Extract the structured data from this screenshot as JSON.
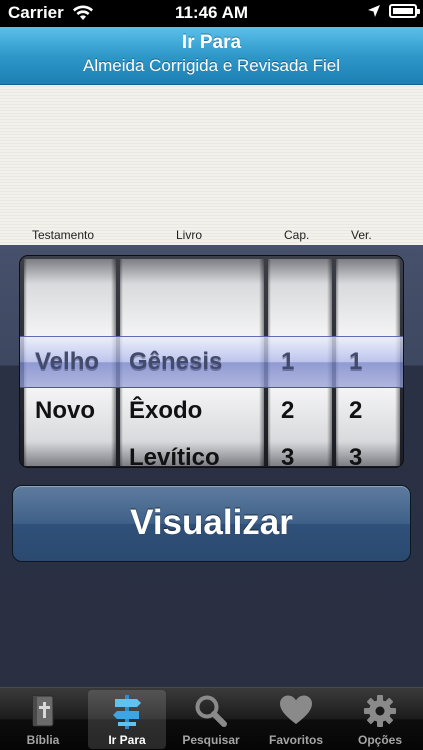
{
  "status_bar": {
    "carrier": "Carrier",
    "time": "11:46 AM"
  },
  "nav": {
    "title": "Ir Para",
    "subtitle": "Almeida Corrigida e Revisada Fiel"
  },
  "picker": {
    "column_labels": {
      "testamento": "Testamento",
      "livro": "Livro",
      "cap": "Cap.",
      "ver": "Ver."
    },
    "selected": {
      "testamento": "Velho",
      "livro": "Gênesis",
      "cap": "1",
      "ver": "1"
    },
    "testamento_items": [
      "Velho",
      "Novo"
    ],
    "livro_items": [
      "Gênesis",
      "Êxodo",
      "Levítico"
    ],
    "cap_items": [
      "1",
      "2",
      "3"
    ],
    "ver_items": [
      "1",
      "2",
      "3"
    ]
  },
  "view_button_label": "Visualizar",
  "tabs": [
    {
      "label": "Bíblia",
      "icon": "bible-icon",
      "selected": false
    },
    {
      "label": "Ir Para",
      "icon": "signpost-icon",
      "selected": true
    },
    {
      "label": "Pesquisar",
      "icon": "magnifier-icon",
      "selected": false
    },
    {
      "label": "Favoritos",
      "icon": "heart-icon",
      "selected": false
    },
    {
      "label": "Opções",
      "icon": "gear-icon",
      "selected": false
    }
  ],
  "colors": {
    "nav_accent": "#2e98c9",
    "button": "#3f6088"
  }
}
